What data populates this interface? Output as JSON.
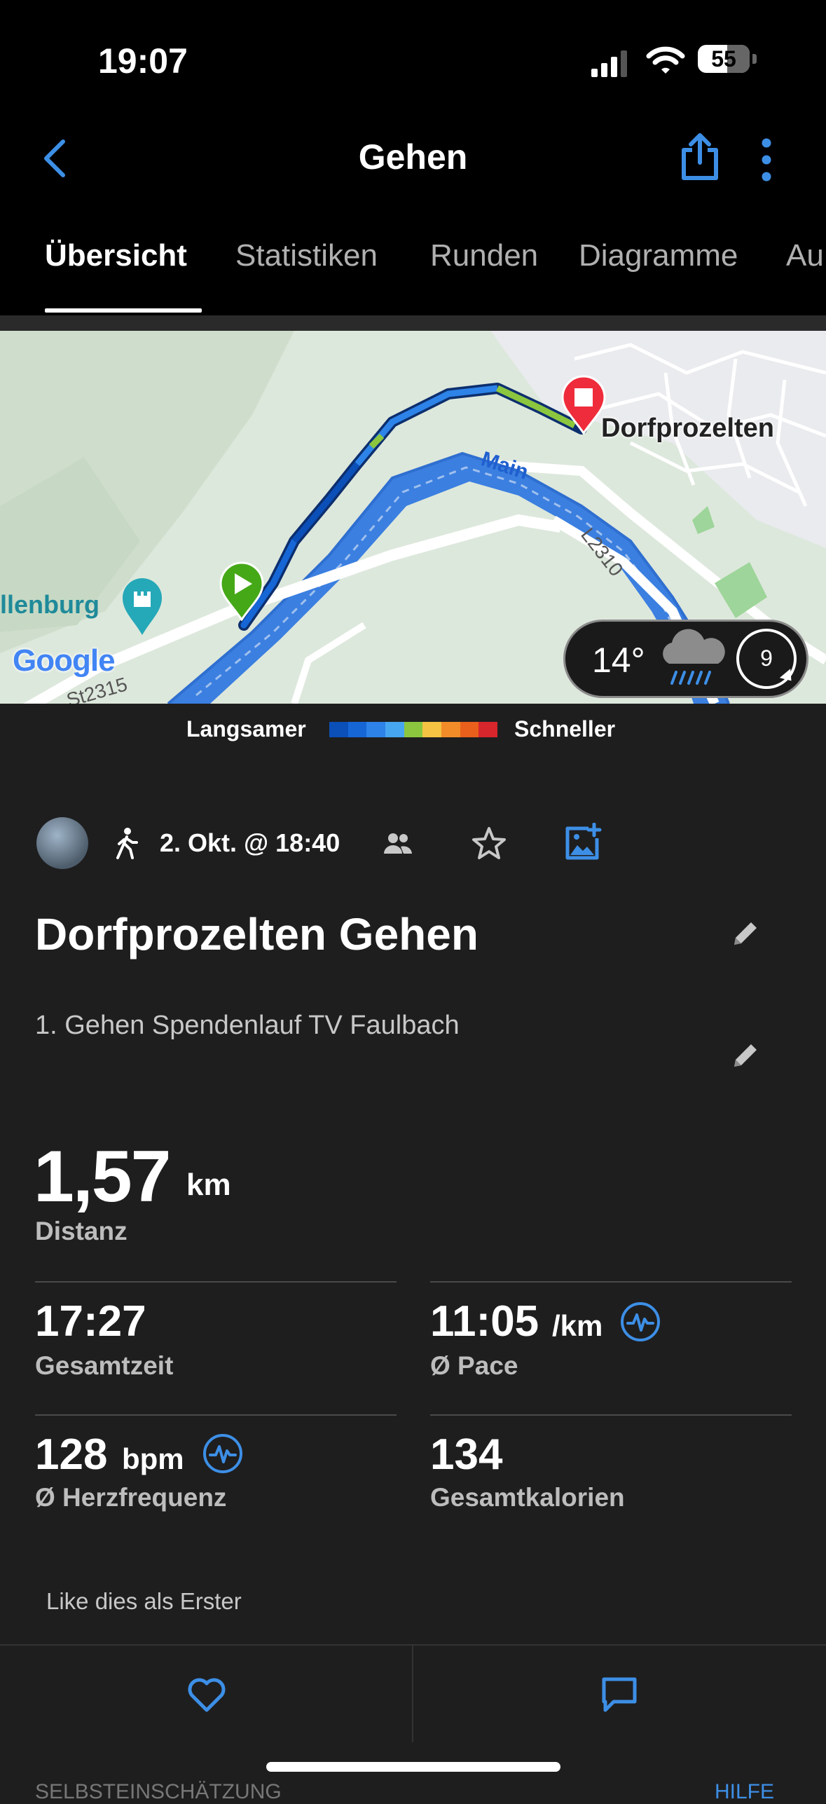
{
  "status_bar": {
    "time": "19:07",
    "battery": "55"
  },
  "nav": {
    "title": "Gehen",
    "tabs": [
      {
        "label": "Übersicht",
        "active": true
      },
      {
        "label": "Statistiken",
        "active": false
      },
      {
        "label": "Runden",
        "active": false
      },
      {
        "label": "Diagramme",
        "active": false
      },
      {
        "label": "Au",
        "active": false
      }
    ]
  },
  "map": {
    "labels": {
      "town": "Dorfprozelten",
      "river": "Main",
      "road1": "L2310",
      "road2": "St2315",
      "poi": "llenburg",
      "provider": "Google"
    },
    "weather": {
      "temp": "14°",
      "wind": "9"
    },
    "legend": {
      "slower": "Langsamer",
      "faster": "Schneller",
      "colors": [
        "#0b4fb8",
        "#1666d6",
        "#2d83e8",
        "#47a6f0",
        "#8cc63f",
        "#f6c342",
        "#f28c28",
        "#e8601c",
        "#d7262c"
      ]
    }
  },
  "activity": {
    "date": "2. Okt. @ 18:40",
    "title": "Dorfprozelten Gehen",
    "description": "1. Gehen Spendenlauf TV Faulbach"
  },
  "stats": {
    "distance": {
      "value": "1,57",
      "unit": "km",
      "label": "Distanz"
    },
    "total_time": {
      "value": "17:27",
      "label": "Gesamtzeit"
    },
    "pace": {
      "value": "11:05",
      "unit": "/km",
      "label": "Ø Pace"
    },
    "heart_rate": {
      "value": "128",
      "unit": "bpm",
      "label": "Ø Herzfrequenz"
    },
    "calories": {
      "value": "134",
      "label": "Gesamtkalorien"
    }
  },
  "social": {
    "like_text": "Like dies als Erster"
  },
  "footer_partial": {
    "left": "SELBSTEINSCHÄTZUNG",
    "right": "HILFE"
  },
  "colors": {
    "accent": "#3d8fe6",
    "background": "#1e1e1f"
  }
}
